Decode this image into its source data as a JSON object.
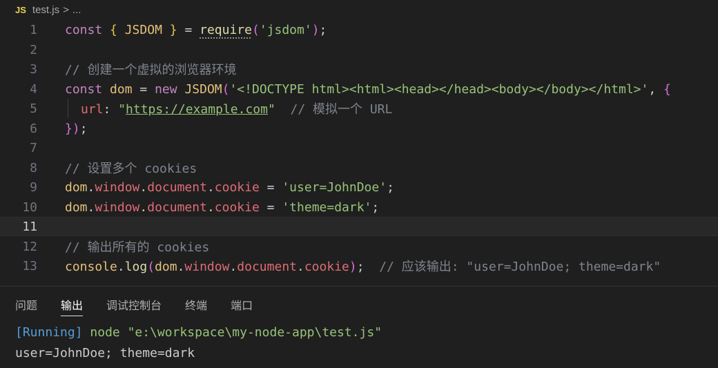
{
  "breadcrumb": {
    "badge": "JS",
    "file": "test.js",
    "sep": ">",
    "more": "..."
  },
  "editor": {
    "active_line": 11,
    "lines": [
      {
        "n": "1"
      },
      {
        "n": "2"
      },
      {
        "n": "3"
      },
      {
        "n": "4"
      },
      {
        "n": "5"
      },
      {
        "n": "6"
      },
      {
        "n": "7"
      },
      {
        "n": "8"
      },
      {
        "n": "9"
      },
      {
        "n": "10"
      },
      {
        "n": "11"
      },
      {
        "n": "12"
      },
      {
        "n": "13"
      }
    ],
    "code": {
      "l1": {
        "kw": "const",
        "open": "{",
        "name": "JSDOM",
        "close": "}",
        "eq": "=",
        "fn": "require",
        "po": "(",
        "str": "'jsdom'",
        "pc": ")",
        "semi": ";"
      },
      "l3": {
        "comment": "// 创建一个虚拟的浏览器环境"
      },
      "l4": {
        "kw": "const",
        "var": "dom",
        "eq": "=",
        "new": "new",
        "cls": "JSDOM",
        "po": "(",
        "str": "'<!DOCTYPE html><html><head></head><body></body></html>'",
        "comma": ",",
        "brace": "{"
      },
      "l5": {
        "key": "url",
        "colon": ":",
        "q1": "\"",
        "url": "https://example.com",
        "q2": "\"",
        "comment": "// 模拟一个 URL"
      },
      "l6": {
        "brace": "}",
        "pc": ")",
        "semi": ";"
      },
      "l8": {
        "comment": "// 设置多个 cookies"
      },
      "l9": {
        "obj": "dom",
        "p1": "window",
        "p2": "document",
        "p3": "cookie",
        "eq": "=",
        "str": "'user=JohnDoe'",
        "semi": ";"
      },
      "l10": {
        "obj": "dom",
        "p1": "window",
        "p2": "document",
        "p3": "cookie",
        "eq": "=",
        "str": "'theme=dark'",
        "semi": ";"
      },
      "l12": {
        "comment": "// 输出所有的 cookies"
      },
      "l13": {
        "obj": "console",
        "fn": "log",
        "po": "(",
        "a": "dom",
        "p1": "window",
        "p2": "document",
        "p3": "cookie",
        "pc": ")",
        "semi": ";",
        "comment": "// 应该输出: \"user=JohnDoe; theme=dark\""
      }
    }
  },
  "panel": {
    "tabs": [
      "问题",
      "输出",
      "调试控制台",
      "终端",
      "端口"
    ],
    "active_tab": "输出",
    "output": {
      "running": "[Running]",
      "command": "node \"e:\\workspace\\my-node-app\\test.js\"",
      "result": "user=JohnDoe; theme=dark"
    }
  },
  "colors": {
    "background": "#1f1f1f",
    "keyword": "#c586c0",
    "string": "#98c379",
    "property": "#e06c75",
    "variable": "#e5c07b",
    "comment": "#7f848e",
    "running": "#569cd6"
  }
}
